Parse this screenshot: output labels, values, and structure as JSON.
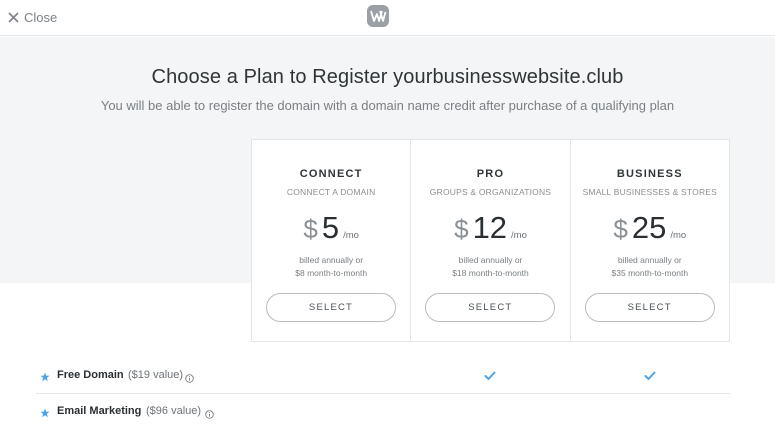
{
  "topbar": {
    "close_label": "Close",
    "logo_icon": "weebly-logo-icon"
  },
  "hero": {
    "title": "Choose a Plan to Register yourbusinesswebsite.club",
    "subtitle": "You will be able to register the domain with a domain name credit after purchase of a qualifying plan"
  },
  "plans": [
    {
      "name": "CONNECT",
      "tagline": "CONNECT A DOMAIN",
      "currency": "$",
      "price": "5",
      "period": "/mo",
      "billing_line1": "billed annually or",
      "billing_line2": "$8 month-to-month",
      "button_label": "SELECT"
    },
    {
      "name": "PRO",
      "tagline": "GROUPS & ORGANIZATIONS",
      "currency": "$",
      "price": "12",
      "period": "/mo",
      "billing_line1": "billed annually or",
      "billing_line2": "$18 month-to-month",
      "button_label": "SELECT"
    },
    {
      "name": "BUSINESS",
      "tagline": "SMALL BUSINESSES & STORES",
      "currency": "$",
      "price": "25",
      "period": "/mo",
      "billing_line1": "billed annually or",
      "billing_line2": "$35 month-to-month",
      "button_label": "SELECT"
    }
  ],
  "features": [
    {
      "name": "Free Domain",
      "value": "($19 value)",
      "included": [
        false,
        true,
        true
      ]
    },
    {
      "name": "Email Marketing",
      "value": "($96 value)",
      "included": [
        false,
        false,
        false
      ]
    }
  ],
  "colors": {
    "hero_bg": "#f4f5f6",
    "check": "#4da3e8",
    "star": "#4da3e8",
    "button_border": "#b9bdc0"
  }
}
